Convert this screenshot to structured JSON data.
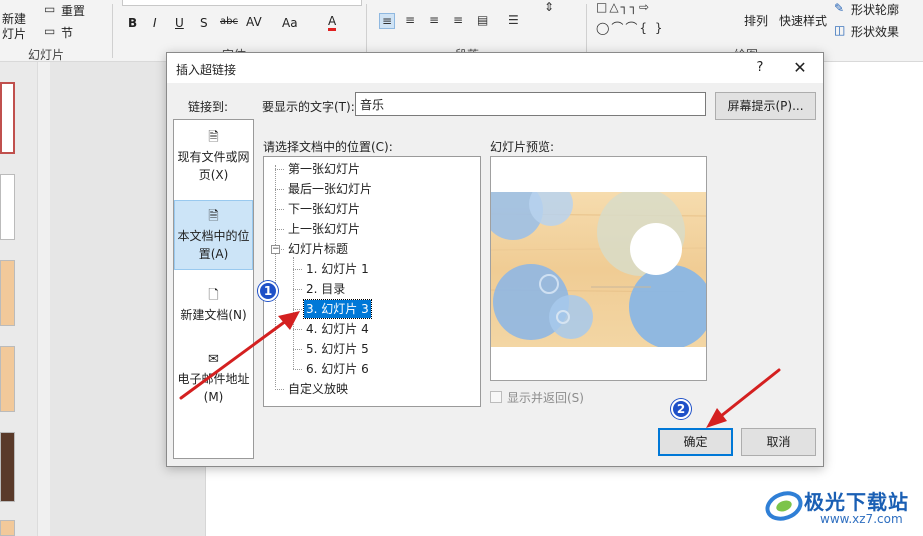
{
  "ribbon": {
    "new_slide_line1": "新建",
    "new_slide_line2": "灯片",
    "reset_label": "重置",
    "section_label": "节",
    "group_slides": "幻灯片",
    "group_font": "字体",
    "group_paragraph": "段落",
    "group_drawing": "绘图",
    "arrange_label": "排列",
    "quick_styles_label": "快速样式",
    "shape_outline_label": "形状轮廓",
    "shape_effects_label": "形状效果",
    "bold": "B",
    "italic": "I",
    "underline": "U",
    "shadow": "S",
    "strike": "abc",
    "spacing": "AV",
    "case": "Aa",
    "font_color": "A"
  },
  "dialog": {
    "title": "插入超链接",
    "help_glyph": "?",
    "close_glyph": "✕",
    "link_to_label": "链接到:",
    "display_text_label": "要显示的文字(T):",
    "display_text_value": "音乐",
    "screen_tip_button": "屏幕提示(P)...",
    "select_place_label": "请选择文档中的位置(C):",
    "preview_label": "幻灯片预览:",
    "show_and_return": "显示并返回(S)",
    "ok_button": "确定",
    "cancel_button": "取消",
    "link_to_items": [
      {
        "line1": "现有文件或网",
        "line2": "页(X)",
        "icon": "globe-file-icon"
      },
      {
        "line1": "本文档中的位",
        "line2": "置(A)",
        "icon": "document-place-icon"
      },
      {
        "line1": "新建文档(N)",
        "line2": "",
        "icon": "new-document-icon"
      },
      {
        "line1": "电子邮件地址",
        "line2": "(M)",
        "icon": "email-icon"
      }
    ],
    "tree": {
      "first": "第一张幻灯片",
      "last": "最后一张幻灯片",
      "next": "下一张幻灯片",
      "prev": "上一张幻灯片",
      "titles": "幻灯片标题",
      "slide1": "1. 幻灯片 1",
      "slide2": "2. 目录",
      "slide3": "3. 幻灯片 3",
      "slide4": "4. 幻灯片 4",
      "slide5": "5. 幻灯片 5",
      "slide6": "6. 幻灯片 6",
      "custom_show": "自定义放映",
      "toggle_glyph": "−"
    }
  },
  "annotations": {
    "badge1": "1",
    "badge2": "2",
    "arrow_color": "#d42020"
  },
  "watermark": {
    "logo_text": "极光下载站",
    "url": "www.xz7.com"
  },
  "colors": {
    "selection": "#0078d7",
    "preview_wood": "#f3d3a0",
    "preview_blue": "#8fb8e0"
  }
}
